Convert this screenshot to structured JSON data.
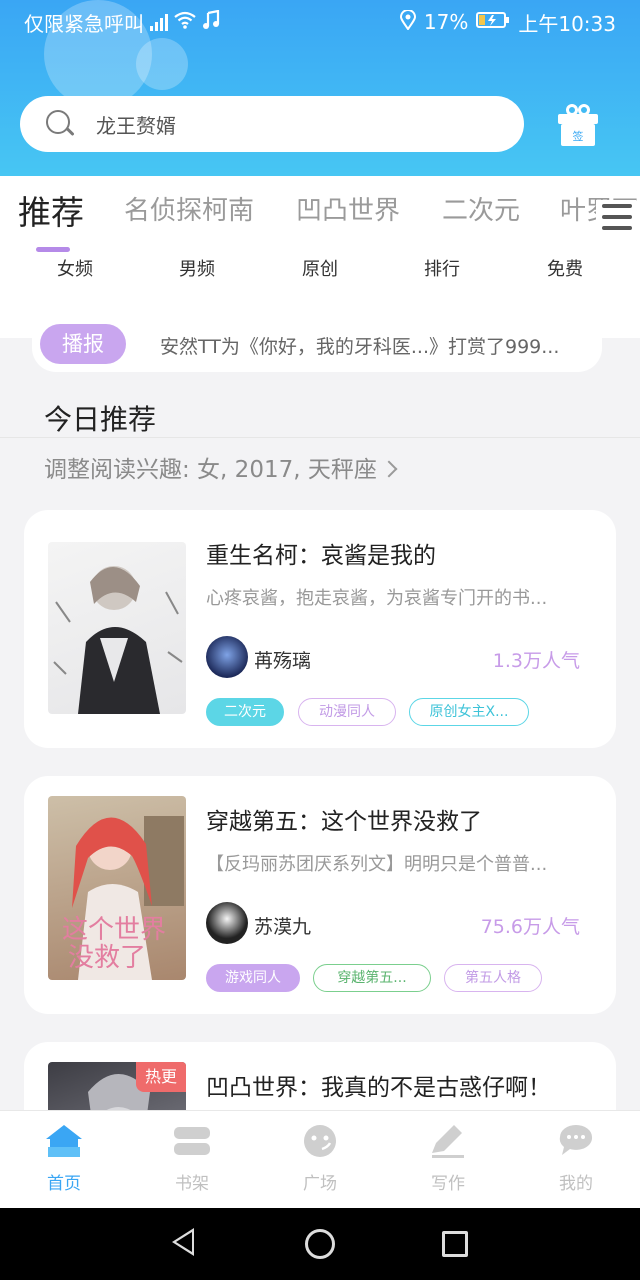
{
  "status_bar": {
    "left_text": "仅限紧急呼叫",
    "battery": "17%",
    "time": "上午10:33"
  },
  "search": {
    "placeholder": "龙王赘婿",
    "gift_label": "签"
  },
  "tabs": [
    {
      "label": "推荐",
      "active": true
    },
    {
      "label": "名侦探柯南"
    },
    {
      "label": "凹凸世界"
    },
    {
      "label": "二次元"
    },
    {
      "label": "叶罗丽"
    }
  ],
  "sub_tabs": [
    "女频",
    "男频",
    "原创",
    "排行",
    "免费"
  ],
  "broadcast": {
    "badge": "播报",
    "text": "安然TT为《你好，我的牙科医...》打赏了999..."
  },
  "section": {
    "title": "今日推荐",
    "preference": "调整阅读兴趣: 女, 2017, 天秤座"
  },
  "books": [
    {
      "title": "重生名柯：哀酱是我的",
      "desc": "心疼哀酱，抱走哀酱，为哀酱专门开的书...",
      "author": "苒殇璃",
      "popularity": "1.3万人气",
      "tags": [
        {
          "label": "二次元",
          "style": "filled-cyan"
        },
        {
          "label": "动漫同人",
          "style": "outline-purple"
        },
        {
          "label": "原创女主X...",
          "style": "outline-cyan"
        }
      ]
    },
    {
      "title": "穿越第五：这个世界没救了",
      "desc": "【反玛丽苏团厌系列文】明明只是个普普...",
      "author": "苏漠九",
      "popularity": "75.6万人气",
      "tags": [
        {
          "label": "游戏同人",
          "style": "filled-purple"
        },
        {
          "label": "穿越第五...",
          "style": "outline-green"
        },
        {
          "label": "第五人格",
          "style": "outline-purple"
        }
      ]
    },
    {
      "title": "凹凸世界：我真的不是古惑仔啊！",
      "badge": "热更"
    }
  ],
  "bottom_nav": [
    {
      "label": "首页",
      "icon": "home-icon",
      "active": true
    },
    {
      "label": "书架",
      "icon": "bookshelf-icon"
    },
    {
      "label": "广场",
      "icon": "plaza-icon"
    },
    {
      "label": "写作",
      "icon": "write-icon"
    },
    {
      "label": "我的",
      "icon": "profile-icon"
    }
  ],
  "colors": {
    "header_gradient": [
      "#3aa6f4",
      "#47c6f3"
    ],
    "accent_purple": "#c9a6ef",
    "accent_blue": "#3aa6f4",
    "hot_red": "#ef6b6b"
  }
}
